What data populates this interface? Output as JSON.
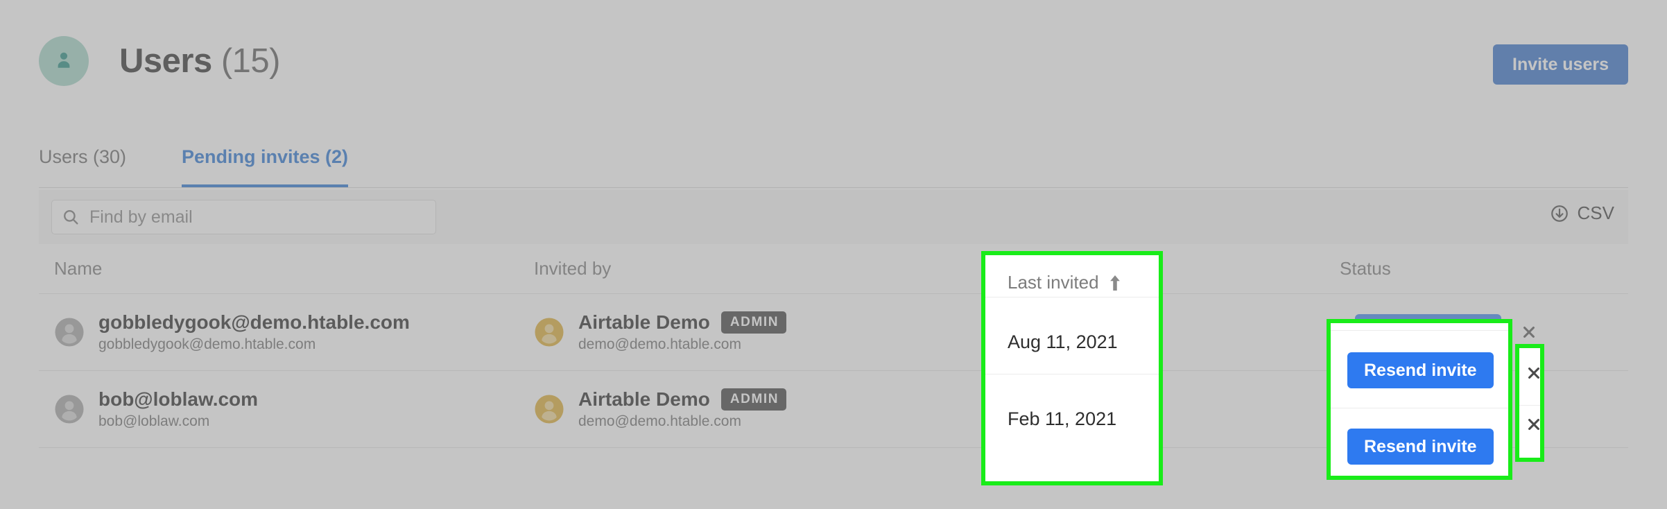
{
  "header": {
    "avatar_icon": "person-icon",
    "title": "Users",
    "count": "(15)",
    "invite_button": "Invite users"
  },
  "tabs": [
    {
      "label": "Users (30)",
      "active": false
    },
    {
      "label": "Pending invites (2)",
      "active": true
    }
  ],
  "toolbar": {
    "search_icon": "search-icon",
    "search_placeholder": "Find by email",
    "search_value": "",
    "csv_icon": "download-circle-icon",
    "csv_label": "CSV"
  },
  "table": {
    "columns": [
      {
        "key": "name",
        "label": "Name"
      },
      {
        "key": "invited_by",
        "label": "Invited by"
      },
      {
        "key": "last_invited",
        "label": "Last invited",
        "sort": "asc",
        "sort_icon": "arrow-up-icon"
      },
      {
        "key": "status",
        "label": "Status"
      }
    ],
    "rows": [
      {
        "avatar_icon": "user-avatar-icon",
        "name": "gobbledygook@demo.htable.com",
        "email": "gobbledygook@demo.htable.com",
        "inviter_avatar_icon": "user-avatar-icon",
        "inviter_name": "Airtable Demo",
        "inviter_badge": "ADMIN",
        "inviter_email": "demo@demo.htable.com",
        "last_invited": "Aug 11, 2021",
        "action_label": "Resend invite",
        "remove_icon": "close-icon"
      },
      {
        "avatar_icon": "user-avatar-icon",
        "name": "bob@loblaw.com",
        "email": "bob@loblaw.com",
        "inviter_avatar_icon": "user-avatar-icon",
        "inviter_name": "Airtable Demo",
        "inviter_badge": "ADMIN",
        "inviter_email": "demo@demo.htable.com",
        "last_invited": "Feb 11, 2021",
        "action_label": "Resend invite",
        "remove_icon": "close-icon"
      }
    ]
  },
  "highlights": {
    "color": "#19ec19",
    "regions": [
      {
        "name": "last-invited-column",
        "target": "Last invited column"
      },
      {
        "name": "resend-invite-buttons",
        "target": "Resend invite buttons"
      },
      {
        "name": "remove-invite-buttons",
        "target": "Remove (x) buttons"
      }
    ]
  },
  "colors": {
    "accent_blue": "#2e7af0",
    "invite_button_blue": "#2264c5",
    "tab_active_blue": "#1267cf",
    "avatar_teal": "#9ad0c2",
    "inviter_avatar_gold": "#d9a520",
    "badge_dark": "#2f2f2f",
    "highlight_green": "#19ec19",
    "dim_overlay": "rgba(150,150,150,0.55)"
  }
}
